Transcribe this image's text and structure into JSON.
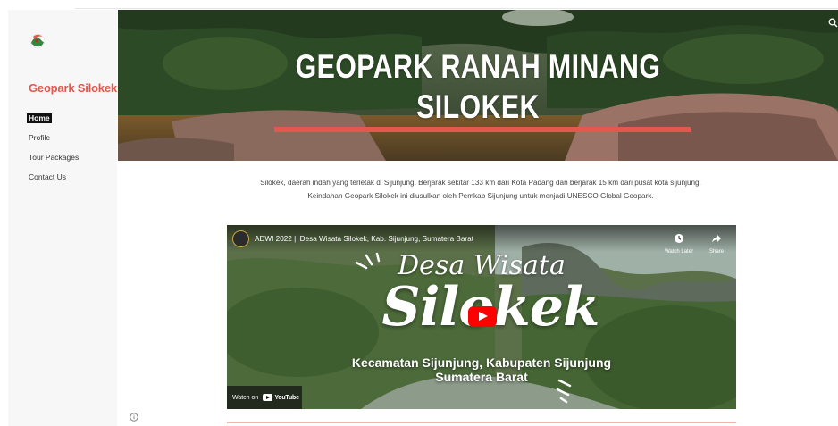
{
  "site": {
    "title": "Geopark Silokek",
    "logo_icon": "geopark-logo-icon"
  },
  "nav": {
    "items": [
      {
        "label": "Home",
        "active": true
      },
      {
        "label": "Profile",
        "active": false
      },
      {
        "label": "Tour Packages",
        "active": false
      },
      {
        "label": "Contact Us",
        "active": false
      }
    ]
  },
  "hero": {
    "title_line1": "GEOPARK RANAH MINANG",
    "title_line2": "SILOKEK",
    "accent_color": "#e4574c"
  },
  "intro": {
    "line1": "Silokek, daerah indah yang terletak di Sijunjung. Berjarak sekitar 133 km dari Kota Padang dan berjarak 15 km dari pusat kota sijunjung.",
    "line2": "Keindahan Geopark Silokek ini diusulkan oleh Pemkab Sijunjung untuk menjadi UNESCO Global Geopark."
  },
  "video": {
    "title": "ADWI 2022 || Desa Wisata Silokek, Kab. Sijunjung, Sumatera Barat",
    "watch_later": "Watch Later",
    "share": "Share",
    "overlay_script": "Desa Wisata",
    "overlay_big": "Silokek",
    "overlay_sub1": "Kecamatan Sijunjung, Kabupaten Sijunjung",
    "overlay_sub2": "Sumatera Barat",
    "watch_on": "Watch on",
    "youtube": "YouTube"
  },
  "icons": {
    "search": "search-icon",
    "info": "info-icon",
    "play": "play-icon",
    "clock": "clock-icon",
    "share": "share-icon"
  }
}
